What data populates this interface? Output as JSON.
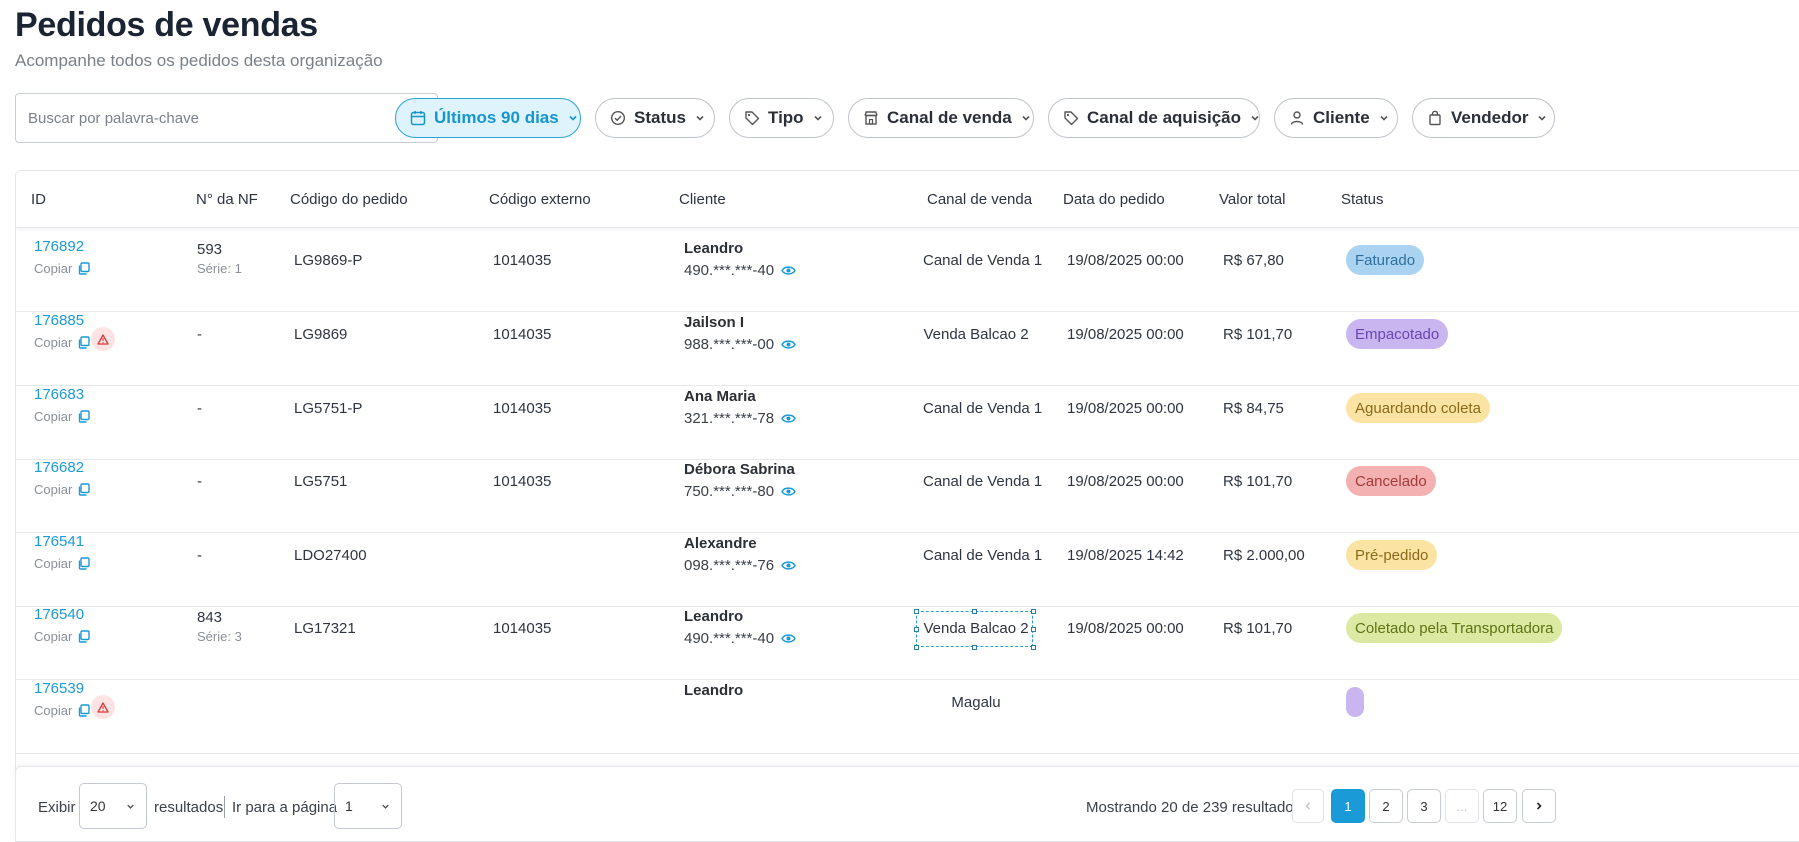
{
  "header": {
    "title": "Pedidos de vendas",
    "subtitle": "Acompanhe todos os pedidos desta organização"
  },
  "search": {
    "placeholder": "Buscar por palavra-chave",
    "value": ""
  },
  "filters": {
    "period": "Últimos 90 dias",
    "status": "Status",
    "type": "Tipo",
    "sales_channel": "Canal de venda",
    "acquisition_channel": "Canal de aquisição",
    "client": "Cliente",
    "seller": "Vendedor"
  },
  "table": {
    "columns": {
      "id": "ID",
      "nf": "N° da NF",
      "order_code": "Código do pedido",
      "external_code": "Código externo",
      "client": "Cliente",
      "channel": "Canal de venda",
      "date": "Data do pedido",
      "total": "Valor total",
      "status": "Status"
    },
    "copy_label": "Copiar",
    "rows": [
      {
        "id": "176892",
        "nf": "593",
        "serie": "Série: 1",
        "order_code": "LG9869-P",
        "external_code": "1014035",
        "client_name": "Leandro",
        "client_doc": "490.***.***-40",
        "channel": "Canal de Venda 1",
        "date": "19/08/2025 00:00",
        "total": "R$ 67,80",
        "status": "Faturado",
        "status_bg": "#a9d3f1",
        "status_color": "#2f6f9f"
      },
      {
        "id": "176885",
        "nf": "-",
        "serie": "",
        "order_code": "LG9869",
        "external_code": "1014035",
        "client_name": "Jailson I",
        "client_doc": "988.***.***-00",
        "channel": "Venda Balcao 2",
        "date": "19/08/2025 00:00",
        "total": "R$ 101,70",
        "status": "Empacotado",
        "status_bg": "#c9b5ef",
        "status_color": "#6a45b5",
        "warning": true
      },
      {
        "id": "176683",
        "nf": "-",
        "serie": "",
        "order_code": "LG5751-P",
        "external_code": "1014035",
        "client_name": "Ana Maria",
        "client_doc": "321.***.***-78",
        "channel": "Canal de Venda 1",
        "date": "19/08/2025 00:00",
        "total": "R$ 84,75",
        "status": "Aguardando coleta",
        "status_bg": "#fbe3a3",
        "status_color": "#8a6a1a"
      },
      {
        "id": "176682",
        "nf": "-",
        "serie": "",
        "order_code": "LG5751",
        "external_code": "1014035",
        "client_name": "Débora Sabrina",
        "client_doc": "750.***.***-80",
        "channel": "Canal de Venda 1",
        "date": "19/08/2025 00:00",
        "total": "R$ 101,70",
        "status": "Cancelado",
        "status_bg": "#f3b1b1",
        "status_color": "#a43b3b"
      },
      {
        "id": "176541",
        "nf": "-",
        "serie": "",
        "order_code": "LDO27400",
        "external_code": "",
        "client_name": "Alexandre",
        "client_doc": "098.***.***-76",
        "channel": "Canal de Venda 1",
        "date": "19/08/2025 14:42",
        "total": "R$ 2.000,00",
        "status": "Pré-pedido",
        "status_bg": "#fbe3a3",
        "status_color": "#8a6a1a"
      },
      {
        "id": "176540",
        "nf": "843",
        "serie": "Série: 3",
        "order_code": "LG17321",
        "external_code": "1014035",
        "client_name": "Leandro",
        "client_doc": "490.***.***-40",
        "channel": "Venda Balcao 2",
        "date": "19/08/2025 00:00",
        "total": "R$ 101,70",
        "status": "Coletado pela Transportadora",
        "status_bg": "#dbe9a2",
        "status_color": "#5d7414"
      },
      {
        "id": "176539",
        "nf": "",
        "serie": "",
        "order_code": "",
        "external_code": "",
        "client_name": "Leandro",
        "client_doc": "",
        "channel": "Magalu",
        "date": "",
        "total": "",
        "status": "",
        "status_bg": "#c9b5ef",
        "status_color": "#6a45b5",
        "warning": true
      }
    ]
  },
  "footer": {
    "show_label": "Exibir",
    "page_size": "20",
    "results_label": "resultados",
    "goto_label": "Ir para a página",
    "goto_value": "1",
    "summary": "Mostrando 20 de 239 resultados",
    "pages": [
      "1",
      "2",
      "3",
      "...",
      "12"
    ],
    "current_page": "1"
  },
  "colors": {
    "accent": "#1a9ad6",
    "title": "#1b2433"
  }
}
